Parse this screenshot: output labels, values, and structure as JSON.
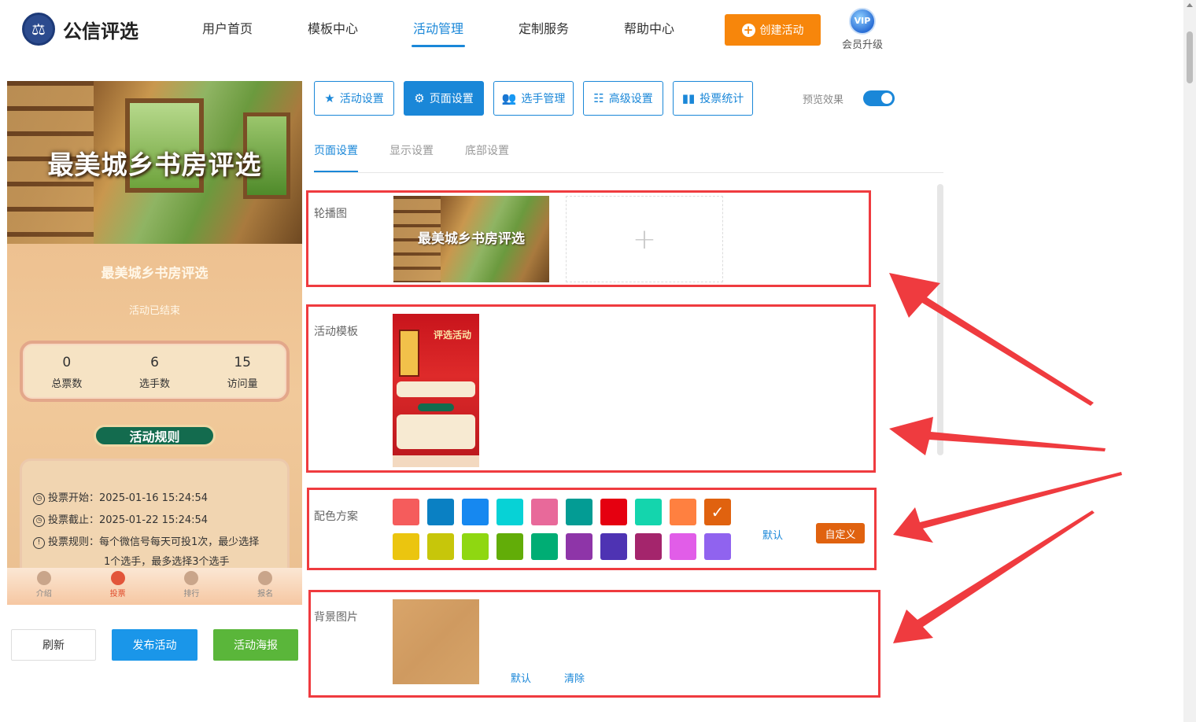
{
  "header": {
    "logo_text": "公信评选",
    "nav": [
      "用户首页",
      "模板中心",
      "活动管理",
      "定制服务",
      "帮助中心"
    ],
    "active_nav_index": 2,
    "create_button": "创建活动",
    "vip_badge": "VIP",
    "vip_label": "会员升级"
  },
  "preview": {
    "hero_title": "最美城乡书房评选",
    "title": "最美城乡书房评选",
    "status": "活动已结束",
    "stats": [
      {
        "value": "0",
        "label": "总票数"
      },
      {
        "value": "6",
        "label": "选手数"
      },
      {
        "value": "15",
        "label": "访问量"
      }
    ],
    "rules_badge": "活动规则",
    "rules": {
      "start": "投票开始：2025-01-16 15:24:54",
      "end": "投票截止：2025-01-22 15:24:54",
      "rule": "投票规则：每个微信号每天可投1次，最少选择",
      "rule_cont": "1个选手，最多选择3个选手"
    },
    "tabs": [
      "介绍",
      "投票",
      "排行",
      "报名"
    ],
    "active_tab_index": 1
  },
  "actions": {
    "refresh": "刷新",
    "publish": "发布活动",
    "poster": "活动海报"
  },
  "tools": [
    {
      "label": "活动设置",
      "icon": "star-icon"
    },
    {
      "label": "页面设置",
      "icon": "gear-icon"
    },
    {
      "label": "选手管理",
      "icon": "users-icon"
    },
    {
      "label": "高级设置",
      "icon": "sliders-icon"
    },
    {
      "label": "投票统计",
      "icon": "bar-chart-icon"
    }
  ],
  "active_tool_index": 1,
  "preview_toggle": {
    "label": "预览效果",
    "on": true
  },
  "subtabs": [
    "页面设置",
    "显示设置",
    "底部设置"
  ],
  "active_subtab_index": 0,
  "sections": {
    "carousel": {
      "label": "轮播图",
      "image_title": "最美城乡书房评选"
    },
    "template": {
      "label": "活动模板",
      "image_title": "评选活动"
    },
    "colors": {
      "label": "配色方案",
      "swatches": [
        "#f55c5c",
        "#0a80c3",
        "#1688f0",
        "#07d2d6",
        "#e8699a",
        "#039c94",
        "#e50010",
        "#14d5ad",
        "#ff8040",
        "#e0620f",
        "#ebc50f",
        "#c7c60a",
        "#8fd711",
        "#62ad08",
        "#00ad74",
        "#8e35a8",
        "#4e33b3",
        "#a4256c",
        "#e15de8",
        "#9063ef"
      ],
      "selected_index": 9,
      "default_link": "默认",
      "custom_button": "自定义"
    },
    "background": {
      "label": "背景图片",
      "default_link": "默认",
      "clear_link": "清除"
    }
  }
}
